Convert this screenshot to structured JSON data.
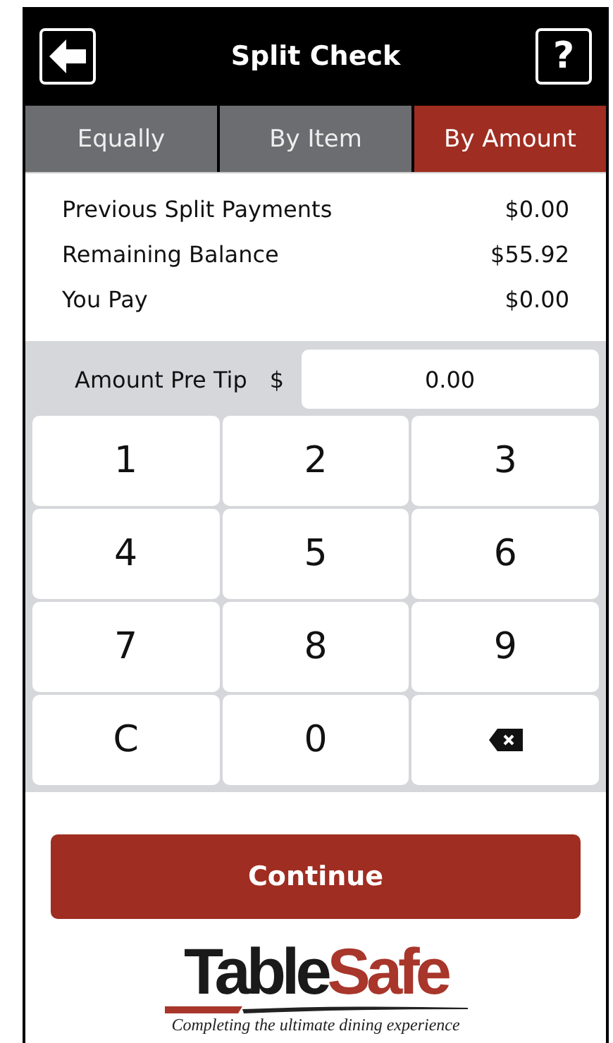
{
  "header": {
    "title": "Split Check",
    "help": "?"
  },
  "tabs": [
    {
      "label": "Equally",
      "selected": false
    },
    {
      "label": "By Item",
      "selected": false
    },
    {
      "label": "By Amount",
      "selected": true
    }
  ],
  "summary": [
    {
      "label": "Previous Split Payments",
      "value": "$0.00"
    },
    {
      "label": "Remaining Balance",
      "value": "$55.92"
    },
    {
      "label": "You Pay",
      "value": "$0.00"
    }
  ],
  "amount": {
    "label": "Amount Pre Tip",
    "currency": "$",
    "value": "0.00"
  },
  "keypad": [
    {
      "kind": "key",
      "label": "1"
    },
    {
      "kind": "key",
      "label": "2"
    },
    {
      "kind": "key",
      "label": "3"
    },
    {
      "kind": "key",
      "label": "4"
    },
    {
      "kind": "key",
      "label": "5"
    },
    {
      "kind": "key",
      "label": "6"
    },
    {
      "kind": "key",
      "label": "7"
    },
    {
      "kind": "key",
      "label": "8"
    },
    {
      "kind": "key",
      "label": "9"
    },
    {
      "kind": "key",
      "label": "C"
    },
    {
      "kind": "key",
      "label": "0"
    },
    {
      "kind": "backspace"
    }
  ],
  "continue_button": "Continue",
  "logo": {
    "dark": "Table",
    "accent": "Safe",
    "tagline": "Completing the ultimate dining experience"
  }
}
